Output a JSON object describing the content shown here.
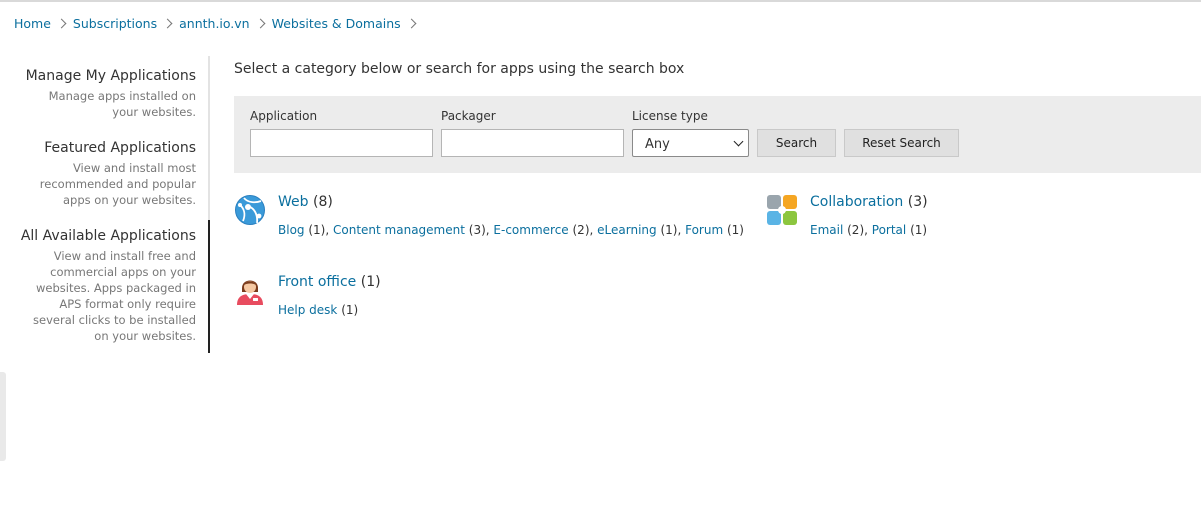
{
  "breadcrumb": [
    "Home",
    "Subscriptions",
    "annth.io.vn",
    "Websites & Domains"
  ],
  "sidebar": {
    "items": [
      {
        "title": "Manage My Applications",
        "desc": [
          "Manage apps installed on",
          "your websites."
        ]
      },
      {
        "title": "Featured Applications",
        "desc": [
          "View and install most",
          "recommended and popular",
          "apps on your websites."
        ]
      },
      {
        "title": "All Available Applications",
        "desc": [
          "View and install free and",
          "commercial apps on your",
          "websites. Apps packaged in",
          "APS format only require",
          "several clicks to be installed",
          "on your websites."
        ]
      }
    ],
    "active_index": 2
  },
  "intro": "Select a category below or search for apps using the search box",
  "search": {
    "application_label": "Application",
    "application_value": "",
    "packager_label": "Packager",
    "packager_value": "",
    "license_label": "License type",
    "license_value": "Any",
    "search_button": "Search",
    "reset_button": "Reset Search"
  },
  "categories": [
    {
      "name": "Web",
      "count": "(8)",
      "icon": "globe-icon",
      "subs": [
        {
          "name": "Blog",
          "count": "(1)"
        },
        {
          "name": "Content management",
          "count": "(3)"
        },
        {
          "name": "E-commerce",
          "count": "(2)"
        },
        {
          "name": "eLearning",
          "count": "(1)"
        },
        {
          "name": "Forum",
          "count": "(1)"
        }
      ]
    },
    {
      "name": "Collaboration",
      "count": "(3)",
      "icon": "collaboration-icon",
      "subs": [
        {
          "name": "Email",
          "count": "(2)"
        },
        {
          "name": "Portal",
          "count": "(1)"
        }
      ]
    },
    {
      "name": "Front office",
      "count": "(1)",
      "icon": "front-office-person-icon",
      "subs": [
        {
          "name": "Help desk",
          "count": "(1)"
        }
      ]
    }
  ],
  "colors": {
    "link": "#0b6f9e",
    "panel_bg": "#ececec",
    "button_bg": "#e0e0e0",
    "globe_blue": "#3a9ad9",
    "collab_orange": "#f5a623",
    "collab_green": "#8cc63f",
    "collab_blue": "#5ab4e5",
    "collab_gray": "#9aa5ad",
    "front_red": "#e84c5f"
  }
}
